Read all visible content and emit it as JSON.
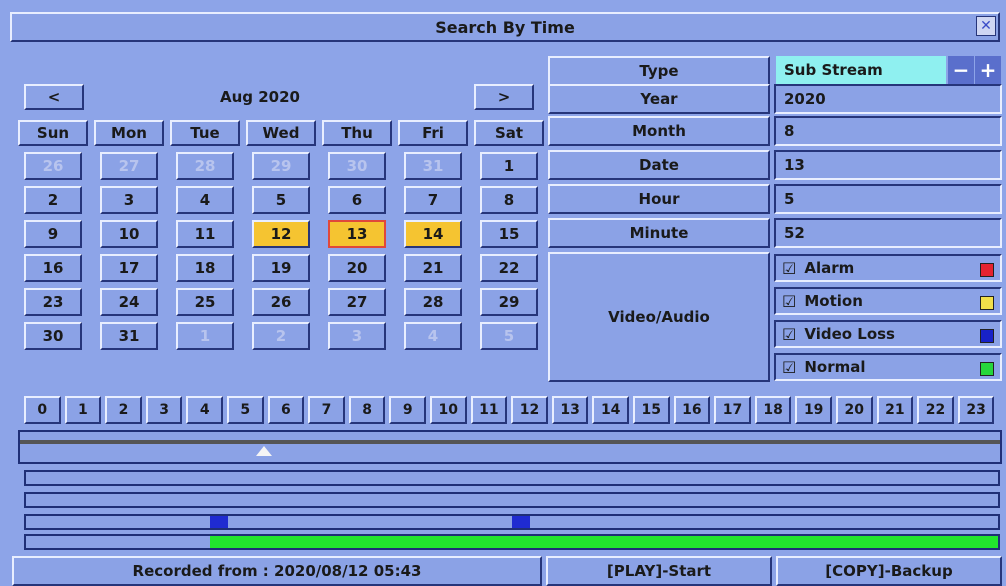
{
  "title": "Search By Time",
  "calendar": {
    "prev": "<",
    "next": ">",
    "month": "Aug 2020",
    "days": [
      "Sun",
      "Mon",
      "Tue",
      "Wed",
      "Thu",
      "Fri",
      "Sat"
    ],
    "weeks": [
      [
        "26",
        "27",
        "28",
        "29",
        "30",
        "31",
        "1"
      ],
      [
        "2",
        "3",
        "4",
        "5",
        "6",
        "7",
        "8"
      ],
      [
        "9",
        "10",
        "11",
        "12",
        "13",
        "14",
        "15"
      ],
      [
        "16",
        "17",
        "18",
        "19",
        "20",
        "21",
        "22"
      ],
      [
        "23",
        "24",
        "25",
        "26",
        "27",
        "28",
        "29"
      ],
      [
        "30",
        "31",
        "1",
        "2",
        "3",
        "4",
        "5"
      ]
    ]
  },
  "fields": {
    "type_label": "Type",
    "type_value": "Sub Stream",
    "year_label": "Year",
    "year_value": "2020",
    "month_label": "Month",
    "month_value": "8",
    "date_label": "Date",
    "date_value": "13",
    "hour_label": "Hour",
    "hour_value": "5",
    "minute_label": "Minute",
    "minute_value": "52",
    "va_label": "Video/Audio"
  },
  "events": [
    {
      "label": "Alarm",
      "color": "#e5232f"
    },
    {
      "label": "Motion",
      "color": "#f2e04a"
    },
    {
      "label": "Video Loss",
      "color": "#1822c8"
    },
    {
      "label": "Normal",
      "color": "#26d63b"
    }
  ],
  "hours": [
    "0",
    "1",
    "2",
    "3",
    "4",
    "5",
    "6",
    "7",
    "8",
    "9",
    "10",
    "11",
    "12",
    "13",
    "14",
    "15",
    "16",
    "17",
    "18",
    "19",
    "20",
    "21",
    "22",
    "23"
  ],
  "status": {
    "recorded": "Recorded from : 2020/08/12 05:43",
    "play": "[PLAY]-Start",
    "copy": "[COPY]-Backup"
  },
  "colors": {
    "highlight": "#f5c431",
    "selected_border": "#e0483a",
    "record": "#22e52e",
    "marker": "#1f2bd1"
  }
}
